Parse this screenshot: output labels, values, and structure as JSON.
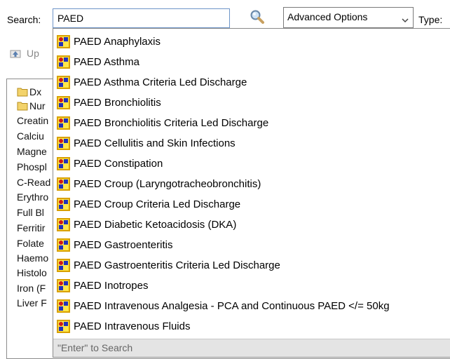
{
  "toolbar": {
    "search_label": "Search:",
    "search_value": "PAED",
    "advanced_options": "Advanced Options",
    "type_label": "Type:",
    "up_label": "Up"
  },
  "tree_items": [
    {
      "label": "Dx",
      "folder": true
    },
    {
      "label": "Nur",
      "folder": true
    },
    {
      "label": "Creatin",
      "folder": false
    },
    {
      "label": "Calciu",
      "folder": false
    },
    {
      "label": "Magne",
      "folder": false
    },
    {
      "label": "Phospl",
      "folder": false
    },
    {
      "label": "C-Read",
      "folder": false
    },
    {
      "label": "Erythro",
      "folder": false
    },
    {
      "label": "Full Bl",
      "folder": false
    },
    {
      "label": "Ferritir",
      "folder": false
    },
    {
      "label": "Folate",
      "folder": false
    },
    {
      "label": "Haemo",
      "folder": false
    },
    {
      "label": "Histolo",
      "folder": false
    },
    {
      "label": "Iron (F",
      "folder": false
    },
    {
      "label": "Liver F",
      "folder": false
    }
  ],
  "suggestions": [
    "PAED Anaphylaxis",
    "PAED Asthma",
    "PAED Asthma Criteria Led Discharge",
    "PAED Bronchiolitis",
    "PAED Bronchiolitis Criteria Led Discharge",
    "PAED Cellulitis and Skin Infections",
    "PAED Constipation",
    "PAED Croup (Laryngotracheobronchitis)",
    "PAED Croup Criteria Led Discharge",
    "PAED Diabetic Ketoacidosis (DKA)",
    "PAED Gastroenteritis",
    "PAED Gastroenteritis Criteria Led Discharge",
    "PAED Inotropes",
    "PAED Intravenous Analgesia - PCA and Continuous PAED </= 50kg",
    "PAED Intravenous Fluids"
  ],
  "enter_hint": "\"Enter\" to Search",
  "colors": {
    "input_border": "#6e95c8",
    "icon_fill": "#ffe84a",
    "icon_border": "#d8a000",
    "hint_bar": "#e4e4e4"
  }
}
